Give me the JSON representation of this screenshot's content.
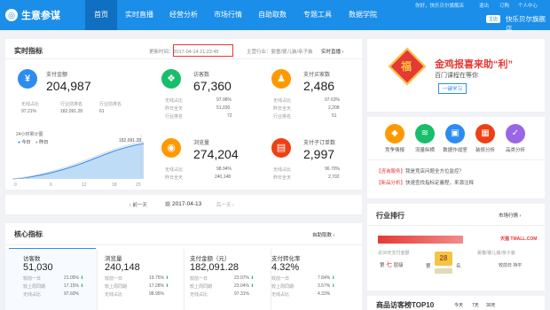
{
  "header": {
    "logo_text": "生意参谋",
    "nav": [
      "首页",
      "实时直播",
      "经营分析",
      "市场行情",
      "自助取数",
      "专题工具",
      "数据学院"
    ],
    "top_links": [
      "你好，快乐贝尔旗舰店",
      "退出",
      "订购",
      "个人中心"
    ],
    "shop_badge": "主店",
    "shop_name": "快乐贝尔旗舰店"
  },
  "realtime": {
    "title": "实时指标",
    "update_time": "更新时间：2017-04-14 21:22:45",
    "industry": "主营行业：婴童/婴儿装/亲子装",
    "live_link": "实时直播",
    "metrics": [
      {
        "label": "支付金额",
        "value": "204,987",
        "icon": "yen-icon",
        "color": "#2d8cf0",
        "rows": [
          [
            "无线占比",
            "97.21%"
          ],
          [
            "行业排名",
            "182,091.28"
          ],
          [
            "行业排名",
            "61"
          ]
        ],
        "sub_left": "无线占比",
        "sub_left_val": "97.21%",
        "sub_mid": "行业前排名",
        "sub_mid_val": "182,091.28",
        "sub_right": "行业前排名",
        "sub_right_val": "61"
      },
      {
        "label": "访客数",
        "value": "67,360",
        "icon": "footprint-icon",
        "color": "#19be6b",
        "rows": [
          [
            "无线占比",
            "97.98%"
          ],
          [
            "昨日全天",
            "51,030"
          ],
          [
            "行业排名",
            "72"
          ]
        ]
      },
      {
        "label": "支付买家数",
        "value": "2,486",
        "icon": "user-icon",
        "color": "#ff9900",
        "rows": [
          [
            "无线占比",
            "97.63%"
          ],
          [
            "昨日全天",
            "2,208"
          ],
          [
            "行业排名",
            "51"
          ]
        ]
      },
      {
        "label": "浏览量",
        "value": "274,204",
        "icon": "eye-icon",
        "color": "#ff9900",
        "rows": [
          [
            "无线占比",
            "98.94%"
          ],
          [
            "昨日全天",
            "240,148"
          ]
        ]
      },
      {
        "label": "支付子订单数",
        "value": "2,997",
        "icon": "order-icon",
        "color": "#ed4014",
        "rows": [
          [
            "无线占比",
            "96.70%"
          ],
          [
            "昨日全天",
            "2,702"
          ]
        ]
      }
    ],
    "chart_title": "24小时累计图",
    "chart_legend": [
      "今日",
      "昨日"
    ],
    "chart_tooltip": "182,091.28",
    "chart_xticks": [
      "0",
      "6",
      "12",
      "18",
      "23"
    ]
  },
  "date_nav": {
    "prev": "前一天",
    "date": "2017-04-13",
    "next": "后一天"
  },
  "core": {
    "title": "核心指标",
    "link": "自助取数",
    "cells": [
      {
        "label": "访客数",
        "value": "51,030",
        "r1": [
          "较前一日",
          "21.05%"
        ],
        "r2": [
          "较上周同期",
          "17.15%"
        ],
        "r3": [
          "无线占比",
          "97.60%"
        ]
      },
      {
        "label": "浏览量",
        "value": "240,148",
        "r1": [
          "较前一日",
          "19.75%"
        ],
        "r2": [
          "较上周同期",
          "17.28%"
        ],
        "r3": [
          "无线占比",
          "98.95%"
        ]
      },
      {
        "label": "支付金额（元）",
        "value": "182,091.28",
        "r1": [
          "较前一日",
          "23.07%"
        ],
        "r2": [
          "较上周同期",
          "23.04%"
        ],
        "r3": [
          "无线占比",
          "97.31%"
        ]
      },
      {
        "label": "支付转化率",
        "value": "4.32%",
        "r1": [
          "较前一日",
          "7.84%"
        ],
        "r2": [
          "较上周同期",
          "3.57%"
        ],
        "r3": [
          "无线占比",
          "4.33%"
        ]
      }
    ]
  },
  "promo": {
    "title": "金鸡报喜来助“利”",
    "subtitle": "百门课程在等你",
    "button": "一键学习",
    "tag": "福"
  },
  "tools": {
    "items": [
      "竞争情报",
      "流量纵横",
      "数据作战室",
      "装修分析",
      "品类分析"
    ],
    "colors": [
      "#ff9900",
      "#19be6b",
      "#2d8cf0",
      "#ed4014",
      "#9a66e4"
    ],
    "news": [
      [
        "【咨询服务】",
        "我是竞店问题全方位监控？"
      ],
      [
        "【新品分析】",
        "快速查找指标定義程，来源注释"
      ]
    ]
  },
  "rank": {
    "title": "行业排行",
    "link": "市场行情",
    "shop": "天猫 TMALL.COM",
    "month": "近30天支付金额",
    "industry": "婴童/婴儿装/亲子装",
    "level_label": "第",
    "level": "七",
    "level_unit": "层级",
    "rank_label": "第",
    "rank_value": "28",
    "rank_unit": "名",
    "prev_rank": "较前日 持平"
  },
  "top10": {
    "title": "商品访客榜TOP10",
    "tabs": [
      "今天",
      "7天",
      "30天"
    ]
  }
}
